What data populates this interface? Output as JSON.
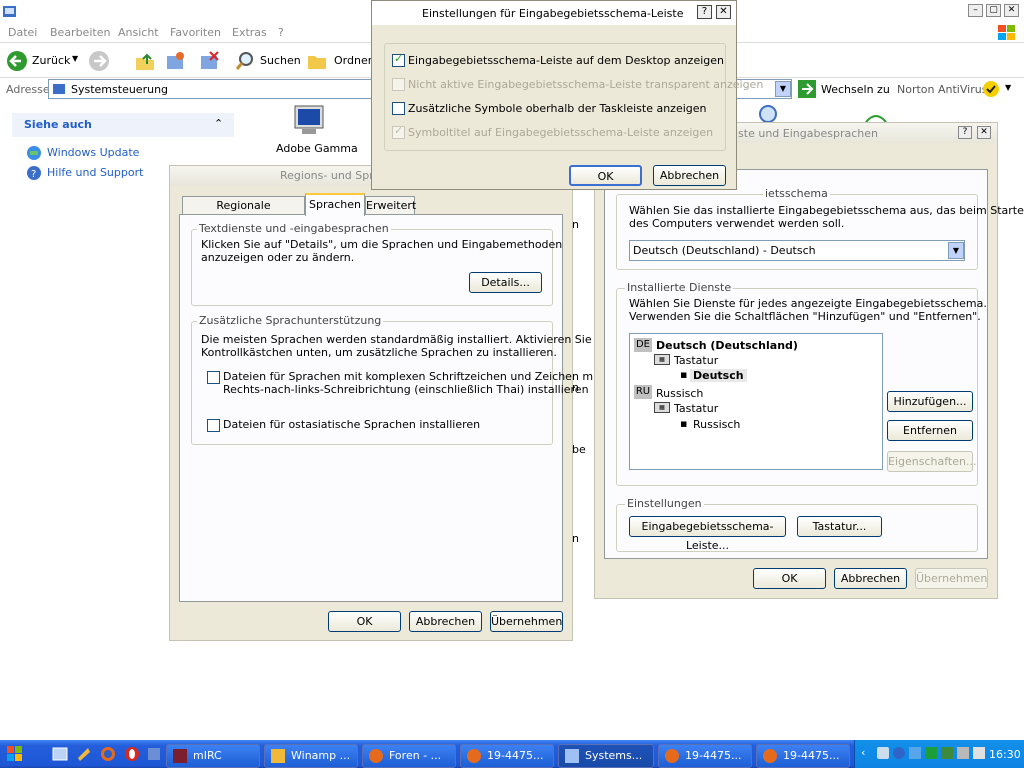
{
  "menu": [
    "Datei",
    "Bearbeiten",
    "Ansicht",
    "Favoriten",
    "Extras",
    "?"
  ],
  "toolbar": {
    "back": "Zurück",
    "search": "Suchen",
    "folders": "Ordner"
  },
  "address": {
    "label": "Adresse",
    "value": "Systemsteuerung",
    "go": "Wechseln zu",
    "norton": "Norton AntiVirus"
  },
  "sidebar": {
    "title": "Siehe auch",
    "items": [
      "Windows Update",
      "Hilfe und Support"
    ]
  },
  "cp_items": [
    "Adobe Gamma"
  ],
  "regional": {
    "title": "Regions- und Sprac",
    "tabs": [
      "Regionale Einstellungen",
      "Sprachen",
      "Erweitert"
    ],
    "text_services_title": "Textdienste und -eingabesprachen",
    "text_services_desc": [
      "Klicken Sie auf \"Details\", um die Sprachen und Eingabemethoden",
      "anzuzeigen oder zu ändern."
    ],
    "details": "Details...",
    "supp_title": "Zusätzliche Sprachunterstützung",
    "supp_desc": [
      "Die meisten Sprachen werden standardmäßig installiert. Aktivieren Sie die",
      "Kontrollkästchen unten, um zusätzliche Sprachen zu installieren."
    ],
    "check1": [
      "Dateien für Sprachen mit komplexen Schriftzeichen und Zeichen mit",
      "Rechts-nach-links-Schreibrichtung (einschließlich Thai) installieren"
    ],
    "check2": "Dateien für ostasiatische Sprachen installieren",
    "ok": "OK",
    "cancel": "Abbrechen",
    "apply": "Übernehmen"
  },
  "textsvc": {
    "title": "iste und Eingabesprachen",
    "default_title": "ietsschema",
    "default_desc": [
      "Wählen Sie das installierte Eingabegebietsschema aus, das beim Starten",
      "des Computers verwendet werden soll."
    ],
    "default_value": "Deutsch (Deutschland) - Deutsch",
    "installed_title": "Installierte Dienste",
    "installed_desc": [
      "Wählen Sie Dienste für jedes angezeigte Eingabegebietsschema.",
      "Verwenden Sie die Schaltflächen \"Hinzufügen\" und \"Entfernen\"."
    ],
    "tree": [
      {
        "badge": "DE",
        "lang": "Deutsch (Deutschland)",
        "kb": "Tastatur",
        "layout": "Deutsch"
      },
      {
        "badge": "RU",
        "lang": "Russisch",
        "kb": "Tastatur",
        "layout": "Russisch"
      }
    ],
    "add": "Hinzufügen...",
    "remove": "Entfernen",
    "props": "Eigenschaften...",
    "settings_title": "Einstellungen",
    "langbar_btn": "Eingabegebietsschema-Leiste...",
    "keyboard_btn": "Tastatur...",
    "ok": "OK",
    "cancel": "Abbrechen",
    "apply": "Übernehmen"
  },
  "langbar": {
    "title": "Einstellungen für Eingabegebietsschema-Leiste",
    "options": [
      {
        "label": "Eingabegebietsschema-Leiste auf dem Desktop anzeigen",
        "checked": true,
        "disabled": false
      },
      {
        "label": "Nicht aktive Eingabegebietsschema-Leiste transparent anzeigen",
        "checked": false,
        "disabled": true
      },
      {
        "label": "Zusätzliche Symbole oberhalb der Taskleiste anzeigen",
        "checked": false,
        "disabled": false
      },
      {
        "label": "Symboltitel auf Eingabegebietsschema-Leiste anzeigen",
        "checked": true,
        "disabled": true
      }
    ],
    "ok": "OK",
    "cancel": "Abbrechen"
  },
  "partial": {
    "a": "n",
    "b": "n",
    "c": "be",
    "d": "n"
  },
  "taskbar": {
    "items": [
      "mIRC",
      "Winamp ...",
      "Foren - ...",
      "19-4475...",
      "Systems...",
      "19-4475...",
      "19-4475..."
    ],
    "clock": "16:30"
  }
}
